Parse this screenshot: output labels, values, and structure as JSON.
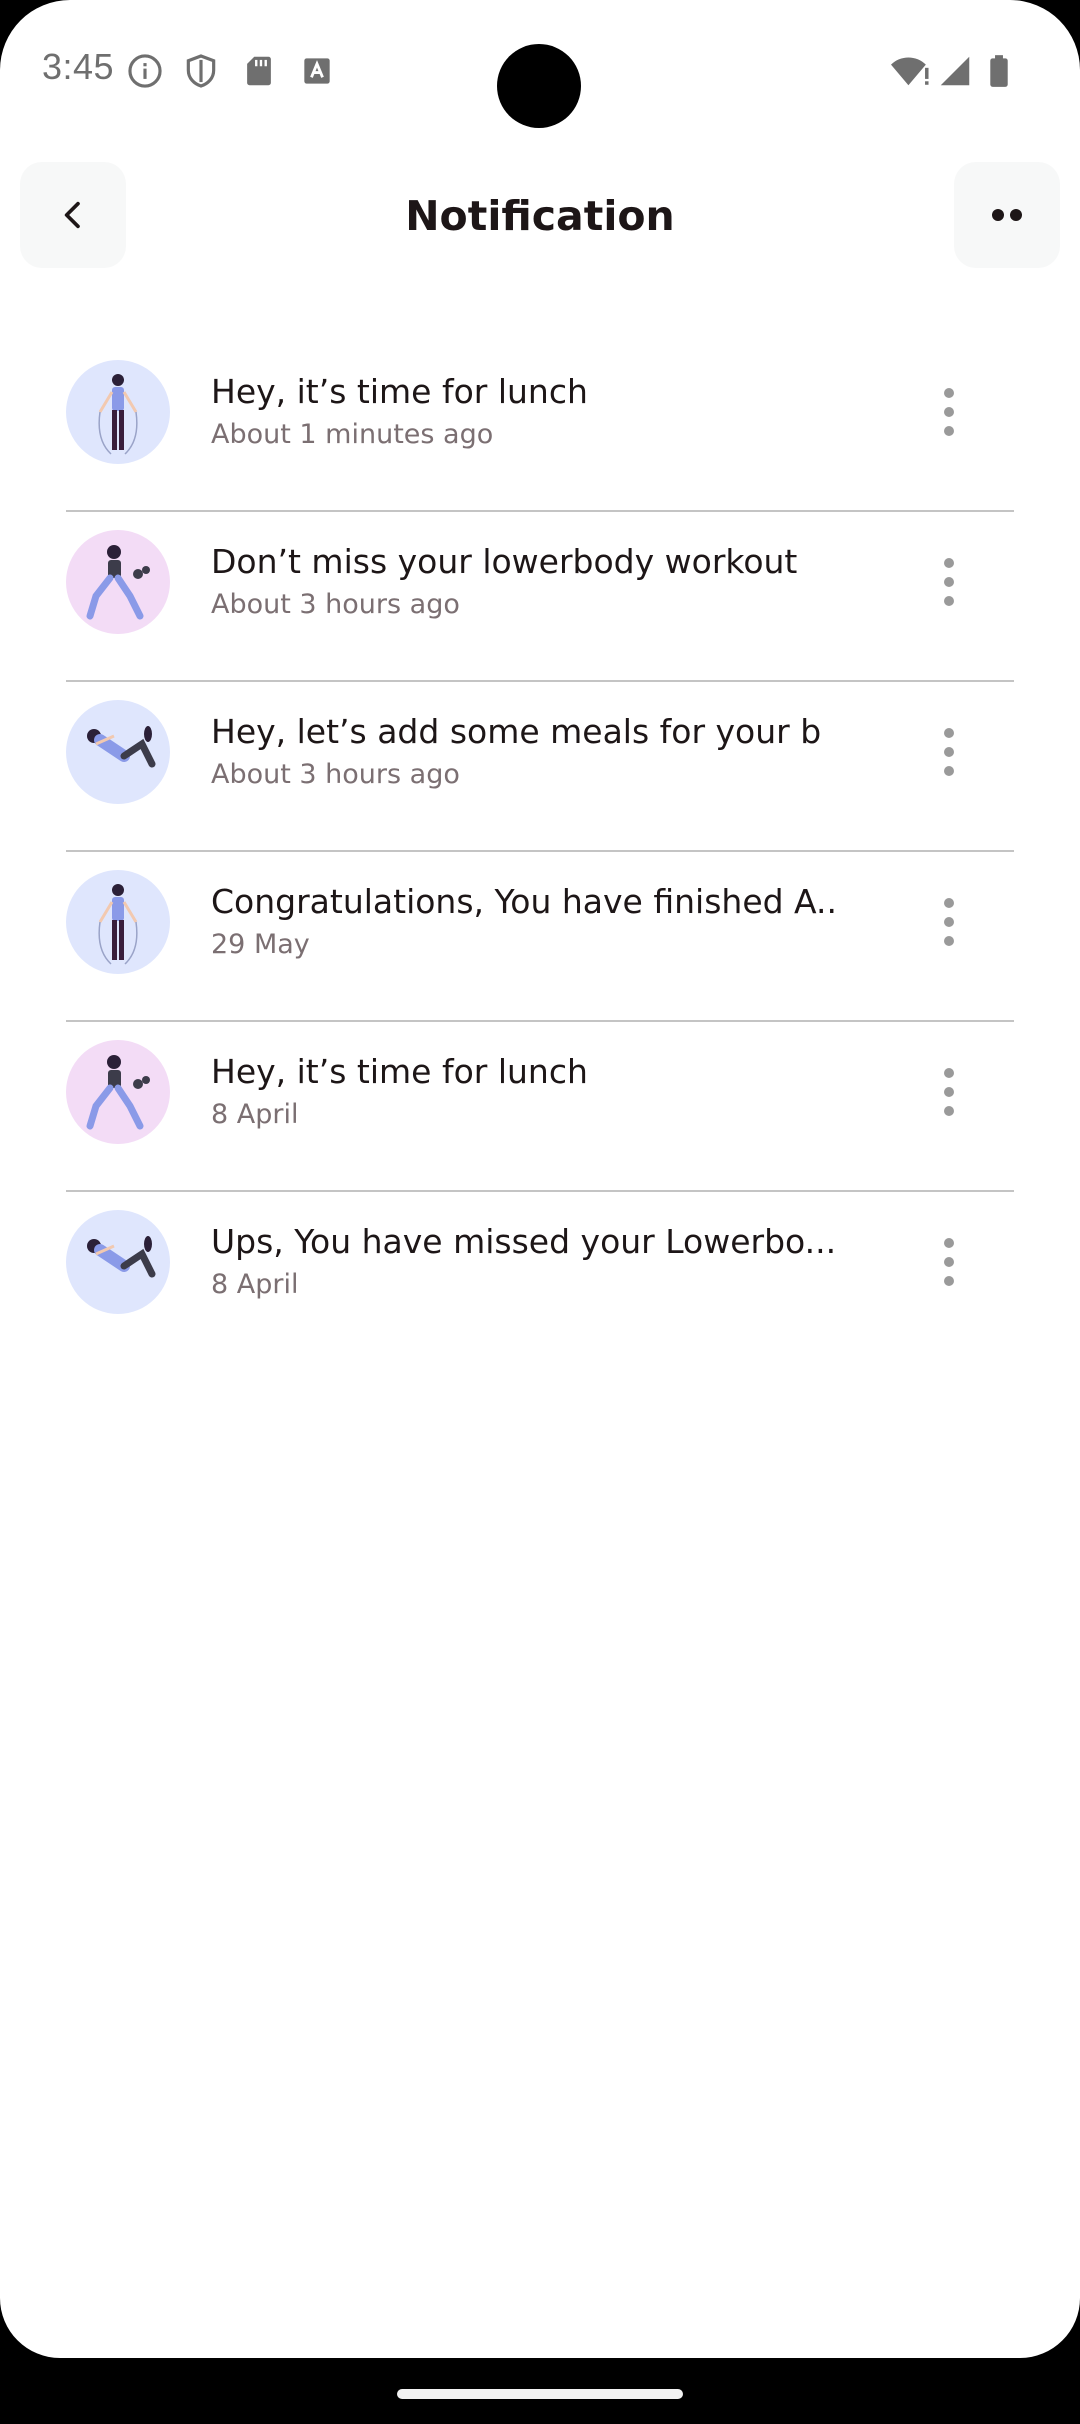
{
  "status_bar": {
    "time": "3:45",
    "left_icons": [
      "info-icon",
      "shield-icon",
      "sd-card-icon",
      "font-a-icon"
    ],
    "right_icons": [
      "wifi-alert-icon",
      "cell-signal-icon",
      "battery-icon"
    ]
  },
  "header": {
    "title": "Notification",
    "back_icon": "chevron-left-icon",
    "more_icon": "two-dots-icon"
  },
  "notifications": [
    {
      "title": "Hey, it’s time for lunch",
      "time": "About 1 minutes ago",
      "avatar": "blue",
      "figure": "jumprope"
    },
    {
      "title": "Don’t miss your lowerbody workout",
      "time": "About 3 hours ago",
      "avatar": "pink",
      "figure": "lunge"
    },
    {
      "title": "Hey, let’s add some meals for your b",
      "time": "About 3 hours ago",
      "avatar": "blue",
      "figure": "situp"
    },
    {
      "title": "Congratulations, You have finished A..",
      "time": "29 May",
      "avatar": "blue",
      "figure": "jumprope"
    },
    {
      "title": "Hey, it’s time for lunch",
      "time": "8 April",
      "avatar": "pink",
      "figure": "lunge"
    },
    {
      "title": "Ups, You have missed your Lowerbo...",
      "time": "8 April",
      "avatar": "blue",
      "figure": "situp"
    }
  ],
  "colors": {
    "title": "#1d1617",
    "subtitle": "#7b6f72",
    "divider": "#c4c4c4",
    "avatar_blue": "#dfe6fd",
    "avatar_pink": "#f3dcf6"
  }
}
